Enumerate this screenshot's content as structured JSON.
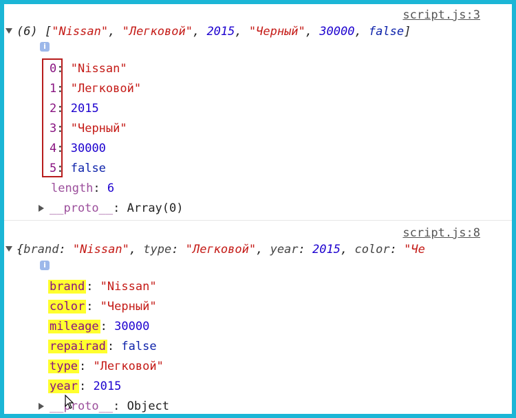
{
  "array_log": {
    "source": "script.js:3",
    "summary_count": "(6)",
    "summary_items": [
      "\"Nissan\"",
      "\"Легковой\"",
      "2015",
      "\"Черный\"",
      "30000",
      "false"
    ],
    "entries": [
      {
        "key": "0",
        "value": "\"Nissan\"",
        "kind": "str"
      },
      {
        "key": "1",
        "value": "\"Легковой\"",
        "kind": "str"
      },
      {
        "key": "2",
        "value": "2015",
        "kind": "num"
      },
      {
        "key": "3",
        "value": "\"Черный\"",
        "kind": "str"
      },
      {
        "key": "4",
        "value": "30000",
        "kind": "num"
      },
      {
        "key": "5",
        "value": "false",
        "kind": "bool"
      }
    ],
    "length_key": "length",
    "length_value": "6",
    "proto_key": "__proto__",
    "proto_value": "Array(0)"
  },
  "object_log": {
    "source": "script.js:8",
    "summary": [
      {
        "key": "brand",
        "value": "\"Nissan\"",
        "kind": "str"
      },
      {
        "key": "type",
        "value": "\"Легковой\"",
        "kind": "str"
      },
      {
        "key": "year",
        "value": "2015",
        "kind": "num"
      },
      {
        "key": "color",
        "value": "\"Че",
        "kind": "str"
      }
    ],
    "entries": [
      {
        "key": "brand",
        "value": "\"Nissan\"",
        "kind": "str"
      },
      {
        "key": "color",
        "value": "\"Черный\"",
        "kind": "str"
      },
      {
        "key": "mileage",
        "value": "30000",
        "kind": "num"
      },
      {
        "key": "repairad",
        "value": "false",
        "kind": "bool"
      },
      {
        "key": "type",
        "value": "\"Легковой\"",
        "kind": "str"
      },
      {
        "key": "year",
        "value": "2015",
        "kind": "num"
      }
    ],
    "proto_key": "__proto__",
    "proto_value": "Object"
  },
  "icons": {
    "info": "info-icon",
    "expand": "expand-triangle-icon",
    "collapse": "collapse-triangle-icon",
    "cursor": "mouse-cursor-icon"
  },
  "colors": {
    "border": "#1bb6d6",
    "highlight": "#ffff2e",
    "box": "#b71c1c",
    "string": "#c41a16",
    "number": "#1c00cf"
  }
}
